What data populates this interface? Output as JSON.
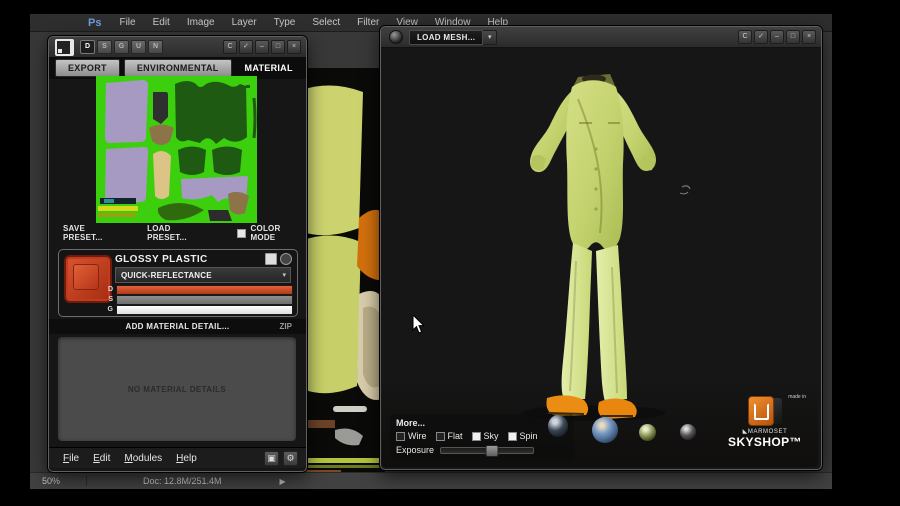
{
  "menubar": {
    "app_logo": "Ps",
    "items": [
      "File",
      "Edit",
      "Image",
      "Layer",
      "Type",
      "Select",
      "Filter",
      "View",
      "Window",
      "Help"
    ]
  },
  "status_bar": {
    "zoom": "50%",
    "doc": "Doc: 12.8M/251.4M",
    "expand_arrow": "▶"
  },
  "panel_window_controls": [
    "C",
    "✓",
    "–",
    "□",
    "×"
  ],
  "ddo_panel": {
    "mode_buttons": [
      "D",
      "S",
      "G",
      "U",
      "N"
    ],
    "tabs": [
      "EXPORT",
      "ENVIRONMENTAL",
      "MATERIAL"
    ],
    "active_tab": "MATERIAL",
    "save_preset": "SAVE PRESET...",
    "load_preset": "LOAD PRESET...",
    "color_mode_label": "COLOR MODE",
    "color_mode_checked": true,
    "material": {
      "name": "GLOSSY PLASTIC",
      "mode_dropdown": "QUICK-REFLECTANCE",
      "dropdown_arrow": "▾",
      "channels": [
        "D",
        "S",
        "G"
      ]
    },
    "add_detail_label": "ADD MATERIAL DETAIL...",
    "zip_label": "ZIP",
    "no_details_label": "NO MATERIAL DETAILS",
    "menu": [
      "File",
      "Edit",
      "Modules",
      "Help"
    ],
    "user_icon": "▣",
    "gear_icon": "⚙"
  },
  "viewer_panel": {
    "load_mesh_label": "LOAD MESH...",
    "dropdown_arrow": "▾",
    "more_label": "More...",
    "toggles": [
      {
        "label": "Wire",
        "checked": false
      },
      {
        "label": "Flat",
        "checked": false
      },
      {
        "label": "Sky",
        "checked": true
      },
      {
        "label": "Spin",
        "checked": true
      }
    ],
    "exposure_label": "Exposure",
    "exposure_percent": 55,
    "branding": {
      "made_in": "made in",
      "brand": "◣MARMOSET",
      "product": "SKYSHOP™"
    }
  },
  "colors": {
    "uv_green": "#3bcf0e",
    "swatch_red": "#c23a1e",
    "diffuse_bar": "#d14e2a",
    "suit_green": "#c8d575",
    "shoe_orange": "#e8860e",
    "brand_orange": "#e2761c"
  }
}
